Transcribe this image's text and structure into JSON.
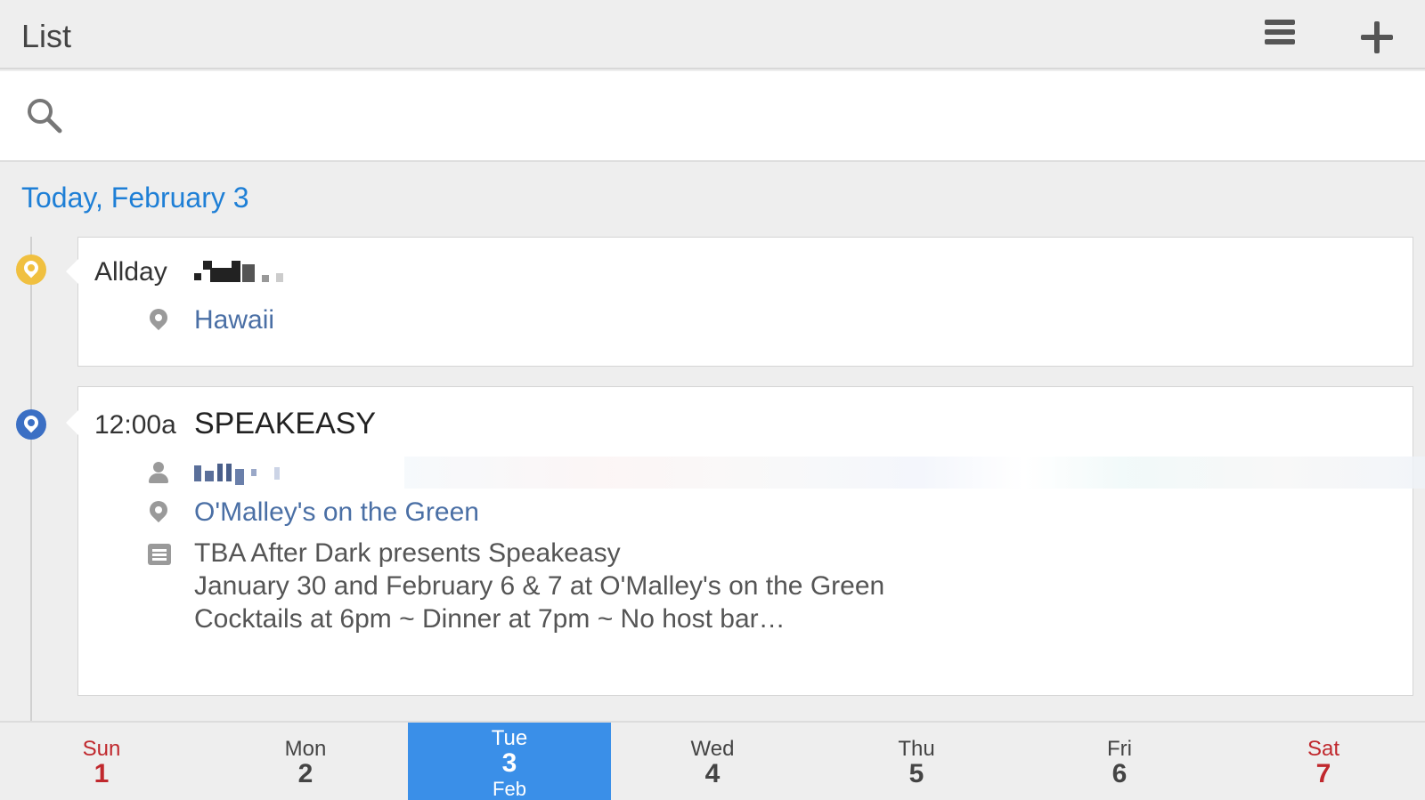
{
  "header": {
    "title": "List",
    "menu_icon": "hamburger-menu-icon",
    "add_icon": "plus-icon"
  },
  "search": {
    "placeholder": "",
    "icon": "search-icon"
  },
  "day_heading": "Today, February 3",
  "events": [
    {
      "time": "Allday",
      "title": "",
      "pin_color": "#f0c040",
      "location": "Hawaii"
    },
    {
      "time": "12:00a",
      "title": "SPEAKEASY",
      "pin_color": "#3b6fc4",
      "location": "O'Malley's on the Green",
      "notes": [
        "TBA After Dark presents Speakeasy",
        "January 30 and February 6 & 7 at O'Malley's on the Green",
        "Cocktails at 6pm ~ Dinner at 7pm ~ No host bar…"
      ]
    }
  ],
  "week": [
    {
      "name": "Sun",
      "day": "1",
      "weekend": true
    },
    {
      "name": "Mon",
      "day": "2"
    },
    {
      "name": "Tue",
      "day": "3",
      "month": "Feb",
      "selected": true
    },
    {
      "name": "Wed",
      "day": "4"
    },
    {
      "name": "Thu",
      "day": "5"
    },
    {
      "name": "Fri",
      "day": "6"
    },
    {
      "name": "Sat",
      "day": "7",
      "weekend": true
    }
  ],
  "colors": {
    "accent": "#1e7fd6",
    "selected_day": "#3a8fe8",
    "weekend": "#c0282d",
    "link": "#4a6fa5"
  }
}
